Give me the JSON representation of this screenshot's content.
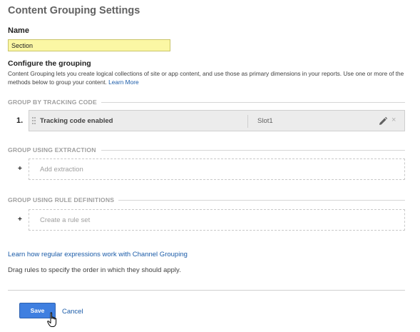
{
  "page": {
    "title": "Content Grouping Settings"
  },
  "name_field": {
    "label": "Name",
    "value": "Section"
  },
  "configure": {
    "heading": "Configure the grouping",
    "description": "Content Grouping lets you create logical collections of site or app content, and use those as primary dimensions in your reports. Use one or more of the methods below to group your content.",
    "learn_more": "Learn More"
  },
  "tracking_code": {
    "heading": "GROUP BY TRACKING CODE",
    "index": "1.",
    "label": "Tracking code enabled",
    "slot": "Slot1",
    "edit_icon": "pencil-icon",
    "remove_icon": "close-icon",
    "remove_glyph": "×"
  },
  "extraction": {
    "heading": "GROUP USING EXTRACTION",
    "plus": "+",
    "add_label": "Add extraction"
  },
  "rules": {
    "heading": "GROUP USING RULE DEFINITIONS",
    "plus": "+",
    "add_label": "Create a rule set"
  },
  "footer": {
    "regex_link": "Learn how regular expressions work with Channel Grouping",
    "drag_note": "Drag rules to specify the order in which they should apply.",
    "save_label": "Save",
    "cancel_label": "Cancel"
  },
  "colors": {
    "accent": "#3f7fe0",
    "link": "#1a5ba8",
    "input_highlight": "#fbf7a4"
  }
}
